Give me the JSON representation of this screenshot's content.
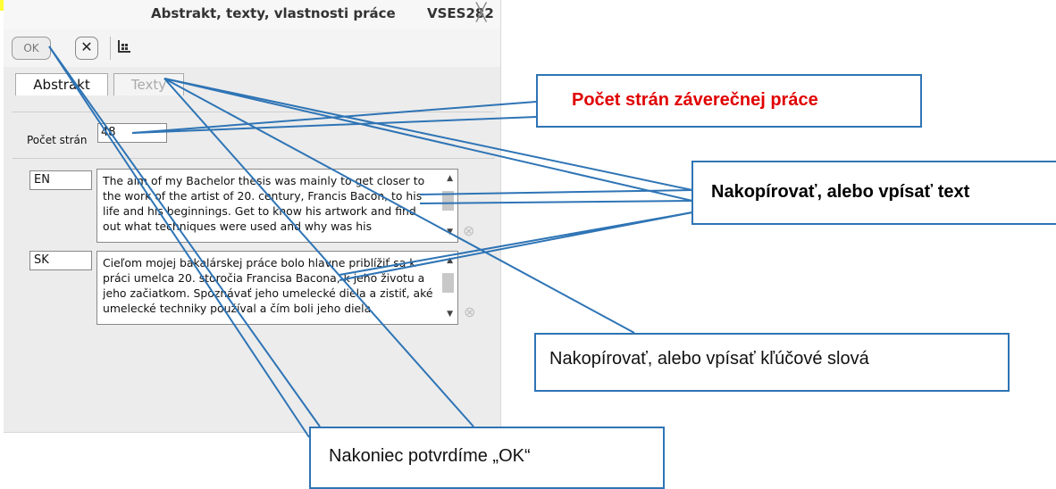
{
  "dialog": {
    "title": "Abstrakt, texty, vlastnosti práce",
    "code": "VSES282",
    "close_glyph": "╳"
  },
  "toolbar": {
    "ok_label": "OK",
    "cancel_glyph": "✕",
    "icons": [
      "table-icon"
    ]
  },
  "tabs": [
    {
      "label": "Abstrakt",
      "active": true
    },
    {
      "label": "Texty",
      "active": false
    }
  ],
  "form": {
    "pages_label": "Počet strán",
    "pages_value": "48"
  },
  "abstracts": [
    {
      "lang": "EN",
      "text": "The aim of my Bachelor thesis was mainly to get closer to the work of the artist of 20. century, Francis Bacon, to his life and his beginnings. Get to know his artwork and find out what techniques were used and why was his"
    },
    {
      "lang": "SK",
      "text": "Cieľom mojej bakalárskej práce bolo hlavne priblížiť sa k práci umelca 20. storočia Francisa Bacona, k jeho životu a jeho začiatkom. Spoznávať jeho umelecké diela a zistiť, aké umelecké techniky používal a čím boli jeho diela"
    }
  ],
  "callouts": {
    "pages": "Počet strán záverečnej práce",
    "copy_text": "Nakopírovať, alebo vpísať text",
    "copy_keywords": "Nakopírovať, alebo vpísať kľúčové slová",
    "confirm_ok": "Nakoniec potvrdíme „OK“"
  },
  "colors": {
    "callout_border": "#2e74b5",
    "callout_title_red": "#e00000",
    "highlight": "#ffff33"
  }
}
